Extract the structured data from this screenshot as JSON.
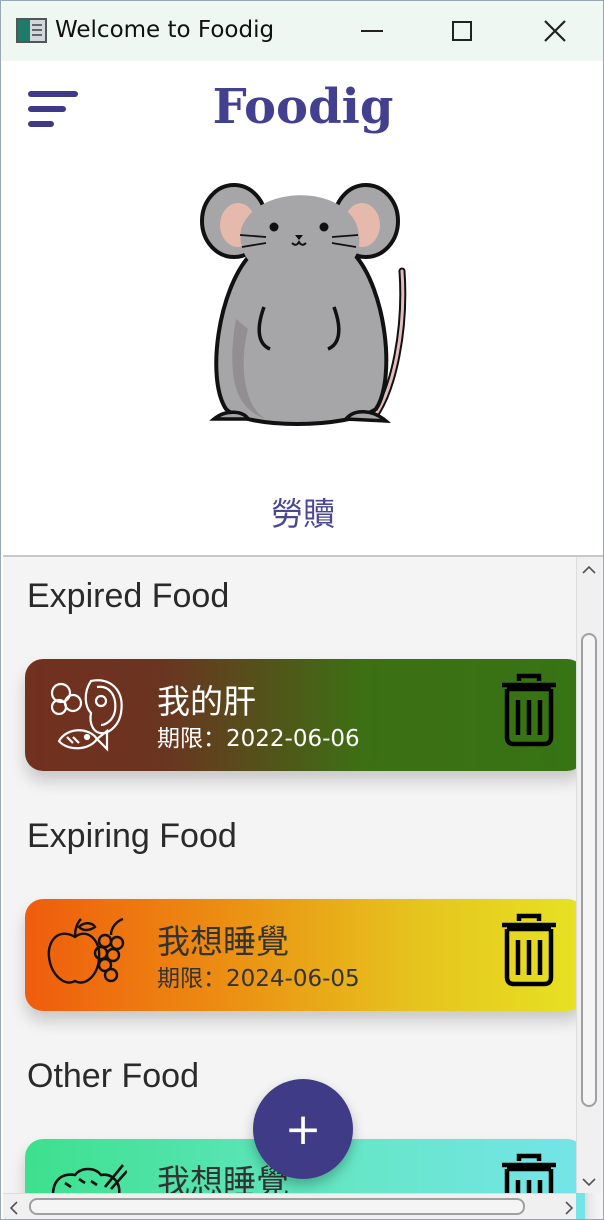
{
  "window": {
    "title": "Welcome to Foodig",
    "icons": {
      "minimize": "minimize-icon",
      "maximize": "maximize-icon",
      "close": "close-icon"
    }
  },
  "header": {
    "brand": "Foodig",
    "menu_icon": "hamburger-menu-icon"
  },
  "profile": {
    "avatar": "mouse-illustration",
    "name": "勞贖"
  },
  "sections": {
    "expired": {
      "title": "Expired Food",
      "items": [
        {
          "name": "我的肝",
          "date": "期限：2022-06-06",
          "icon": "meat-fish-icon",
          "colors": [
            "#72301f",
            "#367414"
          ]
        }
      ]
    },
    "expiring": {
      "title": "Expiring Food",
      "items": [
        {
          "name": "我想睡覺",
          "date": "期限：2024-06-05",
          "icon": "fruit-icon",
          "colors": [
            "#ef5c0d",
            "#e6e322"
          ]
        }
      ]
    },
    "other": {
      "title": "Other Food",
      "items": [
        {
          "name": "我想睡覺",
          "icon": "bowl-icon",
          "colors": [
            "#3de08e",
            "#75e4ea"
          ]
        }
      ]
    }
  },
  "fab": {
    "label": "+"
  },
  "delete_icon": "trash-icon"
}
